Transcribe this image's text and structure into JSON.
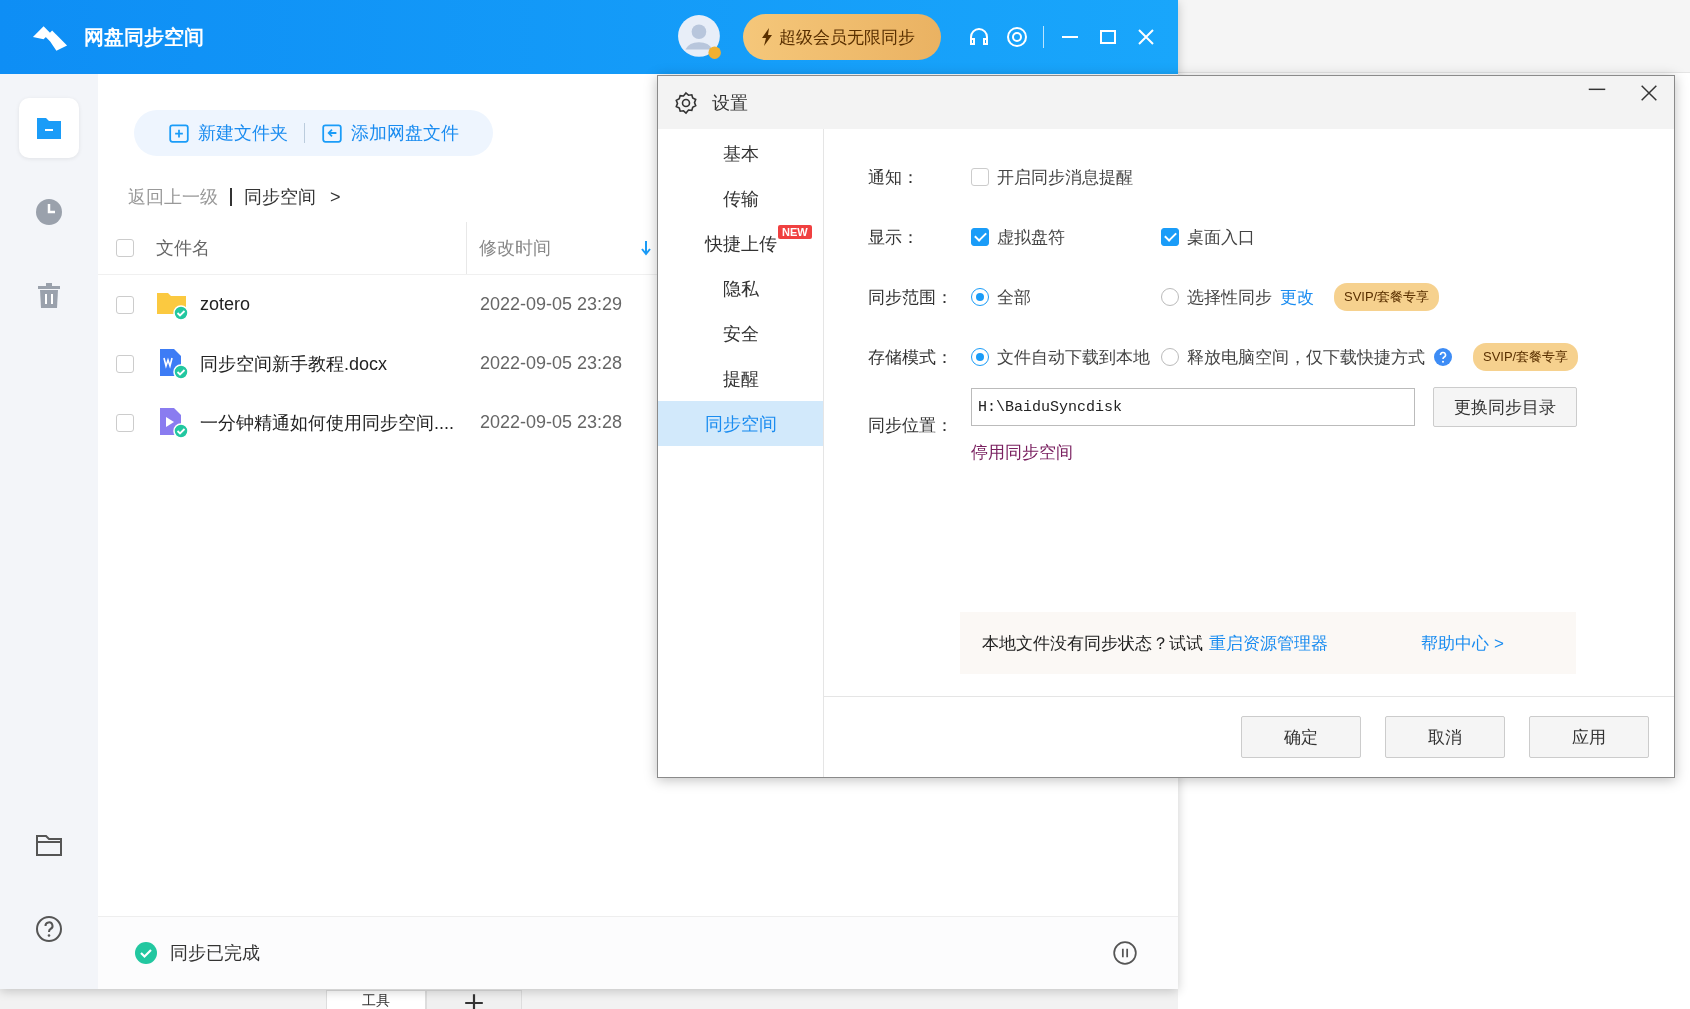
{
  "app": {
    "title": "网盘同步空间",
    "vip_button": "超级会员无限同步"
  },
  "sidebar": [
    {
      "kind": "files",
      "selected": true
    },
    {
      "kind": "recent",
      "selected": false
    },
    {
      "kind": "trash",
      "selected": false
    },
    {
      "kind": "folder",
      "selected": false
    },
    {
      "kind": "help",
      "selected": false
    }
  ],
  "toolbar": [
    "新建文件夹",
    "添加网盘文件"
  ],
  "breadcrumb": {
    "back": "返回上一级",
    "current": "同步空间",
    "separator": ">"
  },
  "table": {
    "select_all": false,
    "columns": [
      "文件名",
      "修改时间"
    ],
    "rows": [
      {
        "kind": "folder",
        "name": "zotero",
        "modified": "2022-09-05 23:29",
        "checked": false
      },
      {
        "kind": "doc",
        "name": "同步空间新手教程.docx",
        "modified": "2022-09-05 23:28",
        "checked": false
      },
      {
        "kind": "video",
        "name": "一分钟精通如何使用同步空间....",
        "modified": "2022-09-05 23:28",
        "checked": false
      }
    ]
  },
  "status_bar": {
    "text": "同步已完成"
  },
  "settings": {
    "title": "设置",
    "nav": [
      {
        "label": "基本",
        "selected": false
      },
      {
        "label": "传输",
        "selected": false
      },
      {
        "label": "快捷上传",
        "selected": false,
        "badge": "NEW"
      },
      {
        "label": "隐私",
        "selected": false
      },
      {
        "label": "安全",
        "selected": false
      },
      {
        "label": "提醒",
        "selected": false
      },
      {
        "label": "同步空间",
        "selected": true
      }
    ],
    "rows": [
      {
        "kind": "checks",
        "label": "通知：",
        "options": [
          {
            "label": "开启同步消息提醒",
            "checked": false
          }
        ]
      },
      {
        "kind": "checks",
        "label": "显示：",
        "options": [
          {
            "label": "虚拟盘符",
            "checked": true
          },
          {
            "label": "桌面入口",
            "checked": true
          }
        ]
      },
      {
        "kind": "radios",
        "label": "同步范围：",
        "options": [
          {
            "label": "全部",
            "selected": true
          },
          {
            "label": "选择性同步",
            "selected": false,
            "link": "更改"
          }
        ],
        "badge": "SVIP/套餐专享"
      },
      {
        "kind": "radios",
        "label": "存储模式：",
        "options": [
          {
            "label": "文件自动下载到本地",
            "selected": true
          },
          {
            "label": "释放电脑空间，仅下载快捷方式",
            "selected": false,
            "help": true
          }
        ],
        "badge": "SVIP/套餐专享"
      },
      {
        "kind": "path",
        "label": "同步位置：",
        "value": "H:\\BaiduSyncdisk",
        "button": "更换同步目录",
        "link": "停用同步空间"
      }
    ],
    "tip": {
      "text": "本地文件没有同步状态？试试",
      "link": "重启资源管理器",
      "help": "帮助中心 >"
    },
    "buttons": [
      "确定",
      "取消",
      "应用"
    ]
  },
  "background_tabs": [
    {
      "label": "工具"
    }
  ]
}
